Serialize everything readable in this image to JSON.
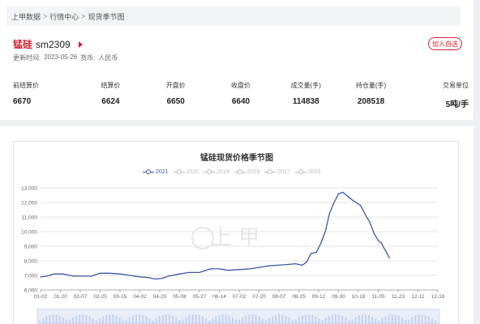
{
  "breadcrumb": [
    "上甲数据",
    ">",
    "行情中心",
    ">",
    "现货季节图"
  ],
  "symbol": {
    "name": "锰硅",
    "code": "sm2309",
    "update_label": "更新时间:",
    "update_time": "2023-05-26",
    "currency_label": "货币:",
    "currency": "人民币",
    "favorite_label": "加入自选"
  },
  "stats": [
    {
      "label": "前结算价",
      "value": "6670"
    },
    {
      "label": "结算价",
      "value": "6624"
    },
    {
      "label": "开盘价",
      "value": "6650"
    },
    {
      "label": "收盘价",
      "value": "6640"
    },
    {
      "label": "成交量(手)",
      "value": "114838"
    },
    {
      "label": "持仓量(手)",
      "value": "208518"
    },
    {
      "label": "交易单位",
      "value": "5吨/手"
    }
  ],
  "watermark": "上 甲",
  "colors": {
    "accent": "#d0232e",
    "series": "#3a5aa8",
    "grid": "#e6e6e6"
  },
  "chart_data": {
    "type": "line",
    "title": "锰硅现货价格季节图",
    "legend": [
      "2021",
      "2020",
      "2019",
      "2018",
      "2017",
      "2016"
    ],
    "legend_active": "2021",
    "legend_position": "top",
    "grid": true,
    "ylim": [
      6000,
      13000
    ],
    "yticks": [
      "6,000",
      "7,000",
      "8,000",
      "9,000",
      "10,000",
      "11,000",
      "12,000",
      "13,000"
    ],
    "xticks": [
      "01-02",
      "01-20",
      "02-07",
      "02-25",
      "03-15",
      "04-02",
      "04-20",
      "05-08",
      "05-27",
      "06-14",
      "07-02",
      "07-20",
      "08-07",
      "08-25",
      "09-12",
      "09-30",
      "10-18",
      "11-05",
      "11-23",
      "12-11",
      "12-18"
    ],
    "series": [
      {
        "name": "2021",
        "x": [
          "01-02",
          "01-08",
          "01-14",
          "01-22",
          "02-01",
          "02-08",
          "02-17",
          "02-25",
          "03-05",
          "03-15",
          "03-24",
          "04-02",
          "04-10",
          "04-16",
          "04-22",
          "04-28",
          "05-08",
          "05-17",
          "05-27",
          "06-06",
          "06-14",
          "06-22",
          "07-02",
          "07-12",
          "07-20",
          "07-28",
          "08-07",
          "08-15",
          "08-22",
          "08-28",
          "09-01",
          "09-05",
          "09-10",
          "09-14",
          "09-18",
          "09-22",
          "09-26",
          "09-30",
          "10-04",
          "10-08",
          "10-12",
          "10-16",
          "10-20",
          "10-24",
          "10-28",
          "11-01",
          "11-05",
          "11-08",
          "11-10",
          "11-13",
          "11-15"
        ],
        "values": [
          6900,
          6950,
          7100,
          7100,
          6950,
          6950,
          6950,
          7150,
          7150,
          7100,
          7000,
          6900,
          6850,
          6750,
          6800,
          6950,
          7100,
          7200,
          7200,
          7450,
          7450,
          7350,
          7400,
          7450,
          7550,
          7650,
          7700,
          7750,
          7800,
          7700,
          7900,
          8500,
          8600,
          9200,
          10000,
          11300,
          12000,
          12600,
          12700,
          12450,
          12200,
          12000,
          11800,
          11200,
          10700,
          9900,
          9400,
          9200,
          8900,
          8500,
          8200
        ]
      }
    ]
  }
}
